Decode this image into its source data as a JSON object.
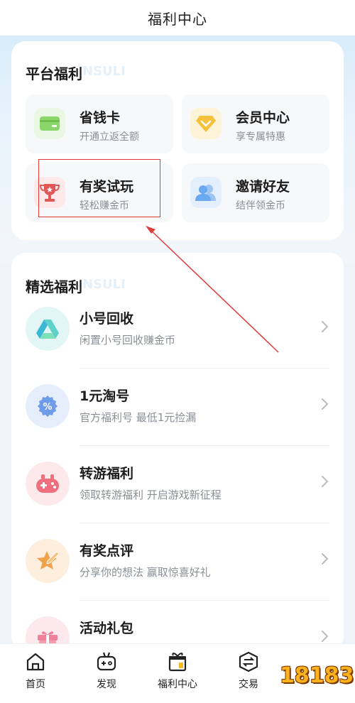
{
  "header": {
    "title": "福利中心"
  },
  "platform": {
    "title": "平台福利",
    "ghost_text": "NSULI",
    "tiles": [
      {
        "title": "省钱卡",
        "subtitle": "开通立返全额",
        "icon": "card-icon"
      },
      {
        "title": "会员中心",
        "subtitle": "享专属特惠",
        "icon": "diamond-icon"
      },
      {
        "title": "有奖试玩",
        "subtitle": "轻松赚金币",
        "icon": "trophy-icon"
      },
      {
        "title": "邀请好友",
        "subtitle": "结伴领金币",
        "icon": "friends-icon"
      }
    ]
  },
  "featured": {
    "title": "精选福利",
    "ghost_text": "NSULI",
    "items": [
      {
        "title": "小号回收",
        "subtitle": "闲置小号回收赚金币",
        "icon": "recycle-icon"
      },
      {
        "title": "1元淘号",
        "subtitle": "官方福利号 最低1元捡漏",
        "icon": "percent-badge-icon"
      },
      {
        "title": "转游福利",
        "subtitle": "领取转游福利 开启游戏新征程",
        "icon": "gamepad-icon"
      },
      {
        "title": "有奖点评",
        "subtitle": "分享你的想法 赢取惊喜好礼",
        "icon": "star-pen-icon"
      },
      {
        "title": "活动礼包",
        "subtitle": "",
        "icon": "gift-icon"
      }
    ]
  },
  "tabbar": {
    "tabs": [
      {
        "label": "首页",
        "icon": "home-icon"
      },
      {
        "label": "发现",
        "icon": "gamepad-icon"
      },
      {
        "label": "福利中心",
        "icon": "gift-box-icon"
      },
      {
        "label": "交易",
        "icon": "exchange-icon"
      }
    ]
  },
  "watermark": {
    "text": "18183"
  },
  "colors": {
    "highlight": "#e03b3b",
    "card_green": "#8bd66a",
    "diamond_yellow": "#f5c13a",
    "trophy_red": "#e05858",
    "friends_blue": "#6aa8ef"
  }
}
